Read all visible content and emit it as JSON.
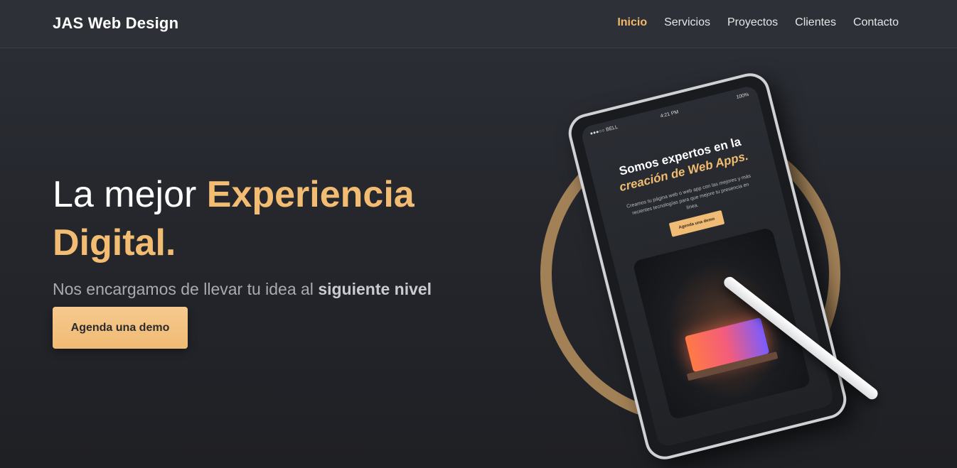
{
  "navbar": {
    "brand": "JAS Web Design",
    "links": [
      {
        "label": "Inicio",
        "active": true
      },
      {
        "label": "Servicios",
        "active": false
      },
      {
        "label": "Proyectos",
        "active": false
      },
      {
        "label": "Clientes",
        "active": false
      },
      {
        "label": "Contacto",
        "active": false
      }
    ]
  },
  "hero": {
    "headline_plain": "La mejor",
    "headline_highlight_1": "Experiencia",
    "headline_highlight_2": "Digital.",
    "sub_plain": "Nos encargamos de llevar tu idea al",
    "sub_bold": "siguiente nivel",
    "cta_label": "Agenda una demo"
  },
  "tablet": {
    "status_left": "●●●○○ BELL",
    "status_time": "4:21 PM",
    "status_right": "100%",
    "title_line1": "Somos expertos en la",
    "title_line2": "creación de Web Apps.",
    "copy": "Creamos tu página web o web app con las mejores y más recientes tecnologías para que mejore tu presencia en línea.",
    "button": "Agenda una demo"
  },
  "colors": {
    "accent": "#f3bc73",
    "background": "#25272d",
    "nav_background": "#2d3037"
  }
}
